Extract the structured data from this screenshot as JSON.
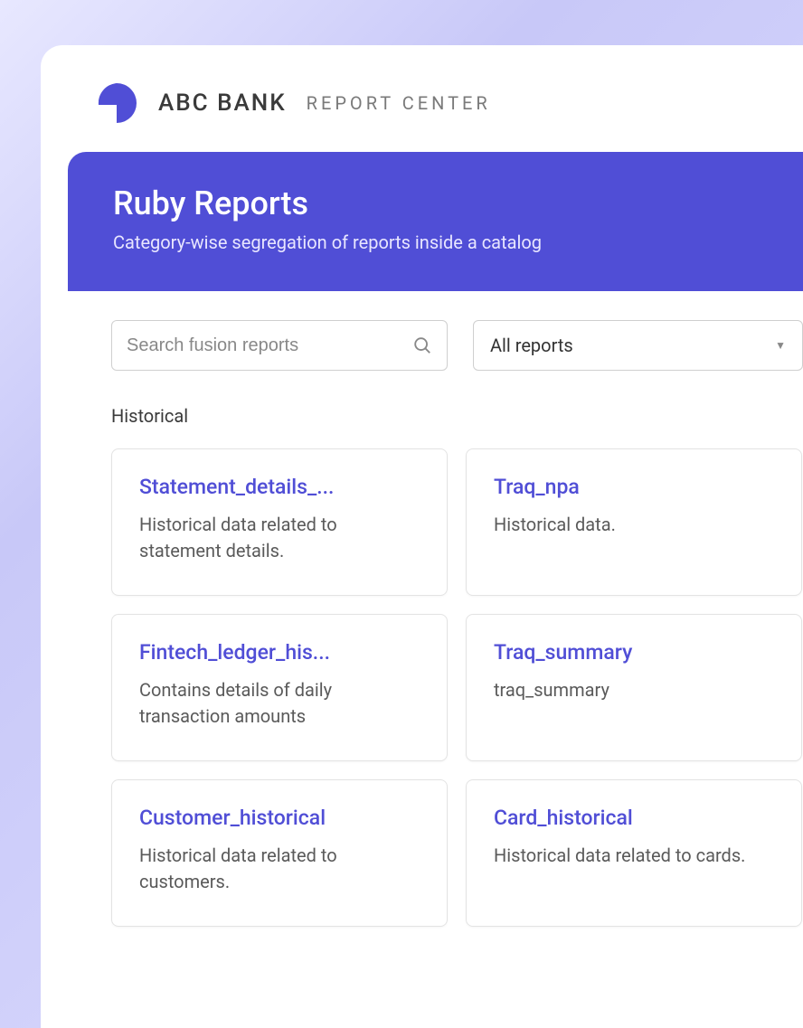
{
  "header": {
    "brand_name": "ABC BANK",
    "app_subtitle": "REPORT CENTER"
  },
  "hero": {
    "title": "Ruby Reports",
    "subtitle": "Category-wise segregation of reports inside a catalog"
  },
  "search": {
    "placeholder": "Search fusion reports"
  },
  "filter": {
    "selected": "All reports"
  },
  "section": {
    "label": "Historical"
  },
  "reports": [
    {
      "title": "Statement_details_...",
      "description": "Historical data related to statement details."
    },
    {
      "title": "Traq_npa",
      "description": "Historical data."
    },
    {
      "title": "Fintech_ledger_his...",
      "description": "Contains details of daily transaction amounts"
    },
    {
      "title": "Traq_summary",
      "description": "traq_summary"
    },
    {
      "title": "Customer_historical",
      "description": "Historical data related to customers."
    },
    {
      "title": "Card_historical",
      "description": "Historical data related to cards."
    }
  ]
}
